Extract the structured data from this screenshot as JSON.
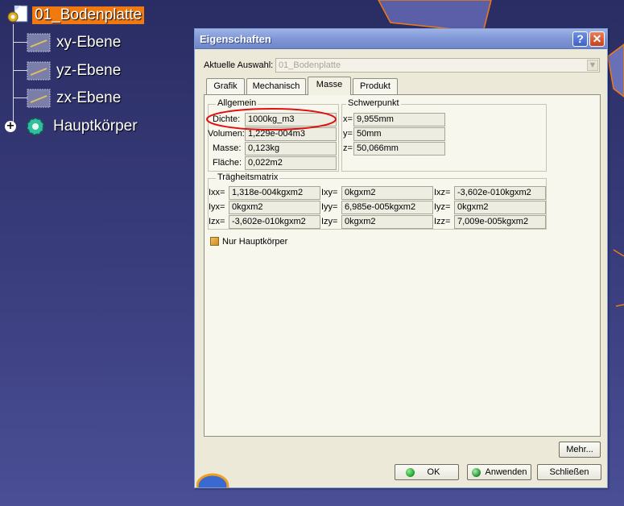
{
  "tree": {
    "root": {
      "label": "01_Bodenplatte",
      "icon": "part-gear-icon"
    },
    "items": [
      {
        "label": "xy-Ebene",
        "icon": "plane-icon"
      },
      {
        "label": "yz-Ebene",
        "icon": "plane-icon"
      },
      {
        "label": "zx-Ebene",
        "icon": "plane-icon"
      },
      {
        "label": "Hauptkörper",
        "icon": "body-gear-icon",
        "expander": "+"
      }
    ]
  },
  "dialog": {
    "title": "Eigenschaften",
    "help_label": "?",
    "close_label": "✕",
    "selection_label": "Aktuelle Auswahl:",
    "selection_value": "01_Bodenplatte",
    "tabs": [
      {
        "label": "Grafik"
      },
      {
        "label": "Mechanisch"
      },
      {
        "label": "Masse",
        "active": true
      },
      {
        "label": "Produkt"
      }
    ],
    "allgemein": {
      "title": "Allgemein",
      "dichte_label": "Dichte:",
      "dichte_value": "1000kg_m3",
      "volumen_label": "Volumen:",
      "volumen_value": "1,229e-004m3",
      "masse_label": "Masse:",
      "masse_value": "0,123kg",
      "flaeche_label": "Fläche:",
      "flaeche_value": "0,022m2"
    },
    "schwerpunkt": {
      "title": "Schwerpunkt",
      "x_label": "x=",
      "x_value": "9,955mm",
      "y_label": "y=",
      "y_value": "50mm",
      "z_label": "z=",
      "z_value": "50,066mm"
    },
    "traegheit": {
      "title": "Trägheitsmatrix",
      "rows": [
        [
          {
            "l": "Ixx=",
            "v": "1,318e-004kgxm2"
          },
          {
            "l": "Ixy=",
            "v": "0kgxm2"
          },
          {
            "l": "Ixz=",
            "v": "-3,602e-010kgxm2"
          }
        ],
        [
          {
            "l": "Iyx=",
            "v": "0kgxm2"
          },
          {
            "l": "Iyy=",
            "v": "6,985e-005kgxm2"
          },
          {
            "l": "Iyz=",
            "v": "0kgxm2"
          }
        ],
        [
          {
            "l": "Izx=",
            "v": "-3,602e-010kgxm2"
          },
          {
            "l": "Izy=",
            "v": "0kgxm2"
          },
          {
            "l": "Izz=",
            "v": "7,009e-005kgxm2"
          }
        ]
      ]
    },
    "checkbox_label": "Nur Hauptkörper",
    "buttons": {
      "mehr": "Mehr...",
      "ok": "OK",
      "anwenden": "Anwenden",
      "schliessen": "Schließen"
    }
  },
  "colors": {
    "selection": "#f07a10",
    "background": "#3a3e7e",
    "annotation": "#e01010"
  }
}
